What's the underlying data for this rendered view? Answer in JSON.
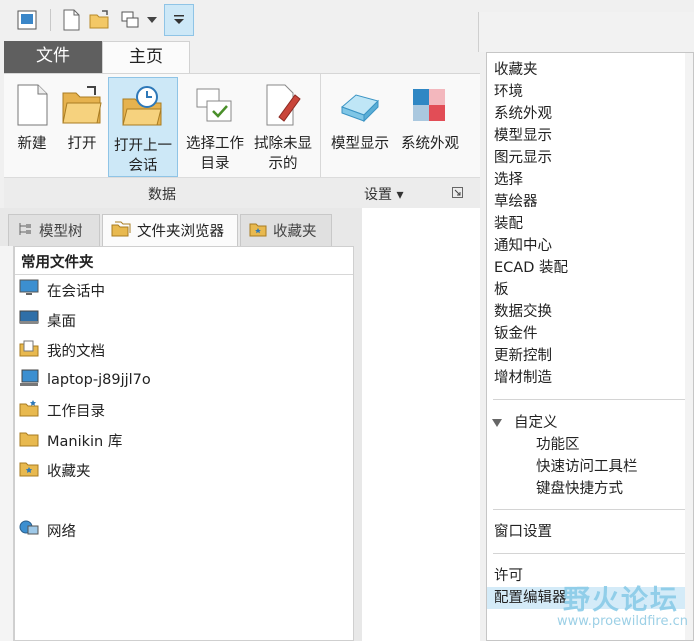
{
  "quick_access": {
    "buttons": [
      "window-icon",
      "new-icon",
      "open-icon",
      "windows-icon",
      "customize-icon"
    ]
  },
  "tabs": {
    "file": "文件",
    "home": "主页"
  },
  "ribbon": {
    "buttons": {
      "new": "新建",
      "open": "打开",
      "open_last_line1": "打开上一",
      "open_last_line2": "会话",
      "select_dir_line1": "选择工作",
      "select_dir_line2": "目录",
      "erase_line1": "拭除未显",
      "erase_line2": "示的",
      "model_display": "模型显示",
      "system_appearance": "系统外观"
    },
    "groups": {
      "data": "数据",
      "settings": "设置 ▾"
    }
  },
  "navigator": {
    "tabs": {
      "model_tree": "模型树",
      "folder_browser": "文件夹浏览器",
      "favorites": "收藏夹"
    },
    "section_title": "常用文件夹",
    "items": [
      "在会话中",
      "桌面",
      "我的文档",
      "laptop-j89jjl7o",
      "工作目录",
      "Manikin 库",
      "收藏夹"
    ],
    "network": "网络"
  },
  "menu": {
    "items": [
      "收藏夹",
      "环境",
      "系统外观",
      "模型显示",
      "图元显示",
      "选择",
      "草绘器",
      "装配",
      "通知中心",
      "ECAD 装配",
      "板",
      "数据交换",
      "钣金件",
      "更新控制",
      "增材制造"
    ],
    "customize": "自定义",
    "customize_items": [
      "功能区",
      "快速访问工具栏",
      "键盘快捷方式"
    ],
    "window_settings": "窗口设置",
    "license": "许可",
    "config_editor": "配置编辑器"
  },
  "watermark": {
    "text": "野火论坛",
    "url": "www.proewildfire.cn"
  },
  "colors": {
    "accent": "#cde8f7",
    "file_tab": "#5f5f5f"
  }
}
